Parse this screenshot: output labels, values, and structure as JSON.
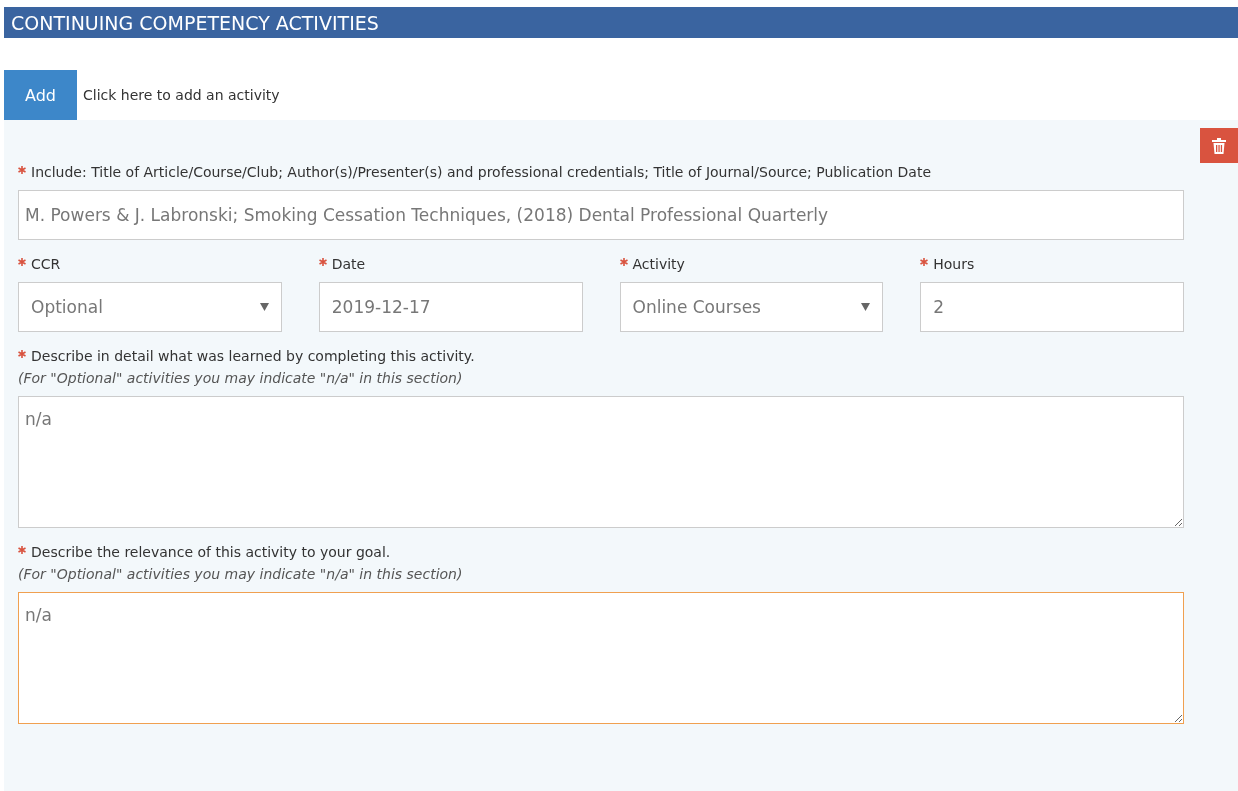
{
  "header": {
    "title": "CONTINUING COMPETENCY ACTIVITIES"
  },
  "add": {
    "button": "Add",
    "hint": "Click here to add an activity"
  },
  "activity": {
    "source": {
      "label": "Include: Title of Article/Course/Club; Author(s)/Presenter(s) and professional credentials; Title of Journal/Source; Publication Date",
      "required": true,
      "value": "M. Powers & J. Labronski; Smoking Cessation Techniques, (2018) Dental Professional Quarterly"
    },
    "fields": [
      {
        "kind": "select",
        "label": "CCR",
        "required": true,
        "value": "Optional"
      },
      {
        "kind": "text",
        "label": "Date",
        "required": true,
        "value": "2019-12-17"
      },
      {
        "kind": "select",
        "label": "Activity",
        "required": true,
        "value": "Online Courses"
      },
      {
        "kind": "text",
        "label": "Hours",
        "required": true,
        "value": "2"
      }
    ],
    "descriptions": [
      {
        "label": "Describe in detail what was learned by completing this activity.",
        "required": true,
        "hint": "(For \"Optional\" activities you may indicate \"n/a\" in this section)",
        "value": "n/a",
        "focused": false
      },
      {
        "label": "Describe the relevance of this activity to your goal.",
        "required": true,
        "hint": "(For \"Optional\" activities you may indicate \"n/a\" in this section)",
        "value": "n/a",
        "focused": true
      }
    ]
  }
}
